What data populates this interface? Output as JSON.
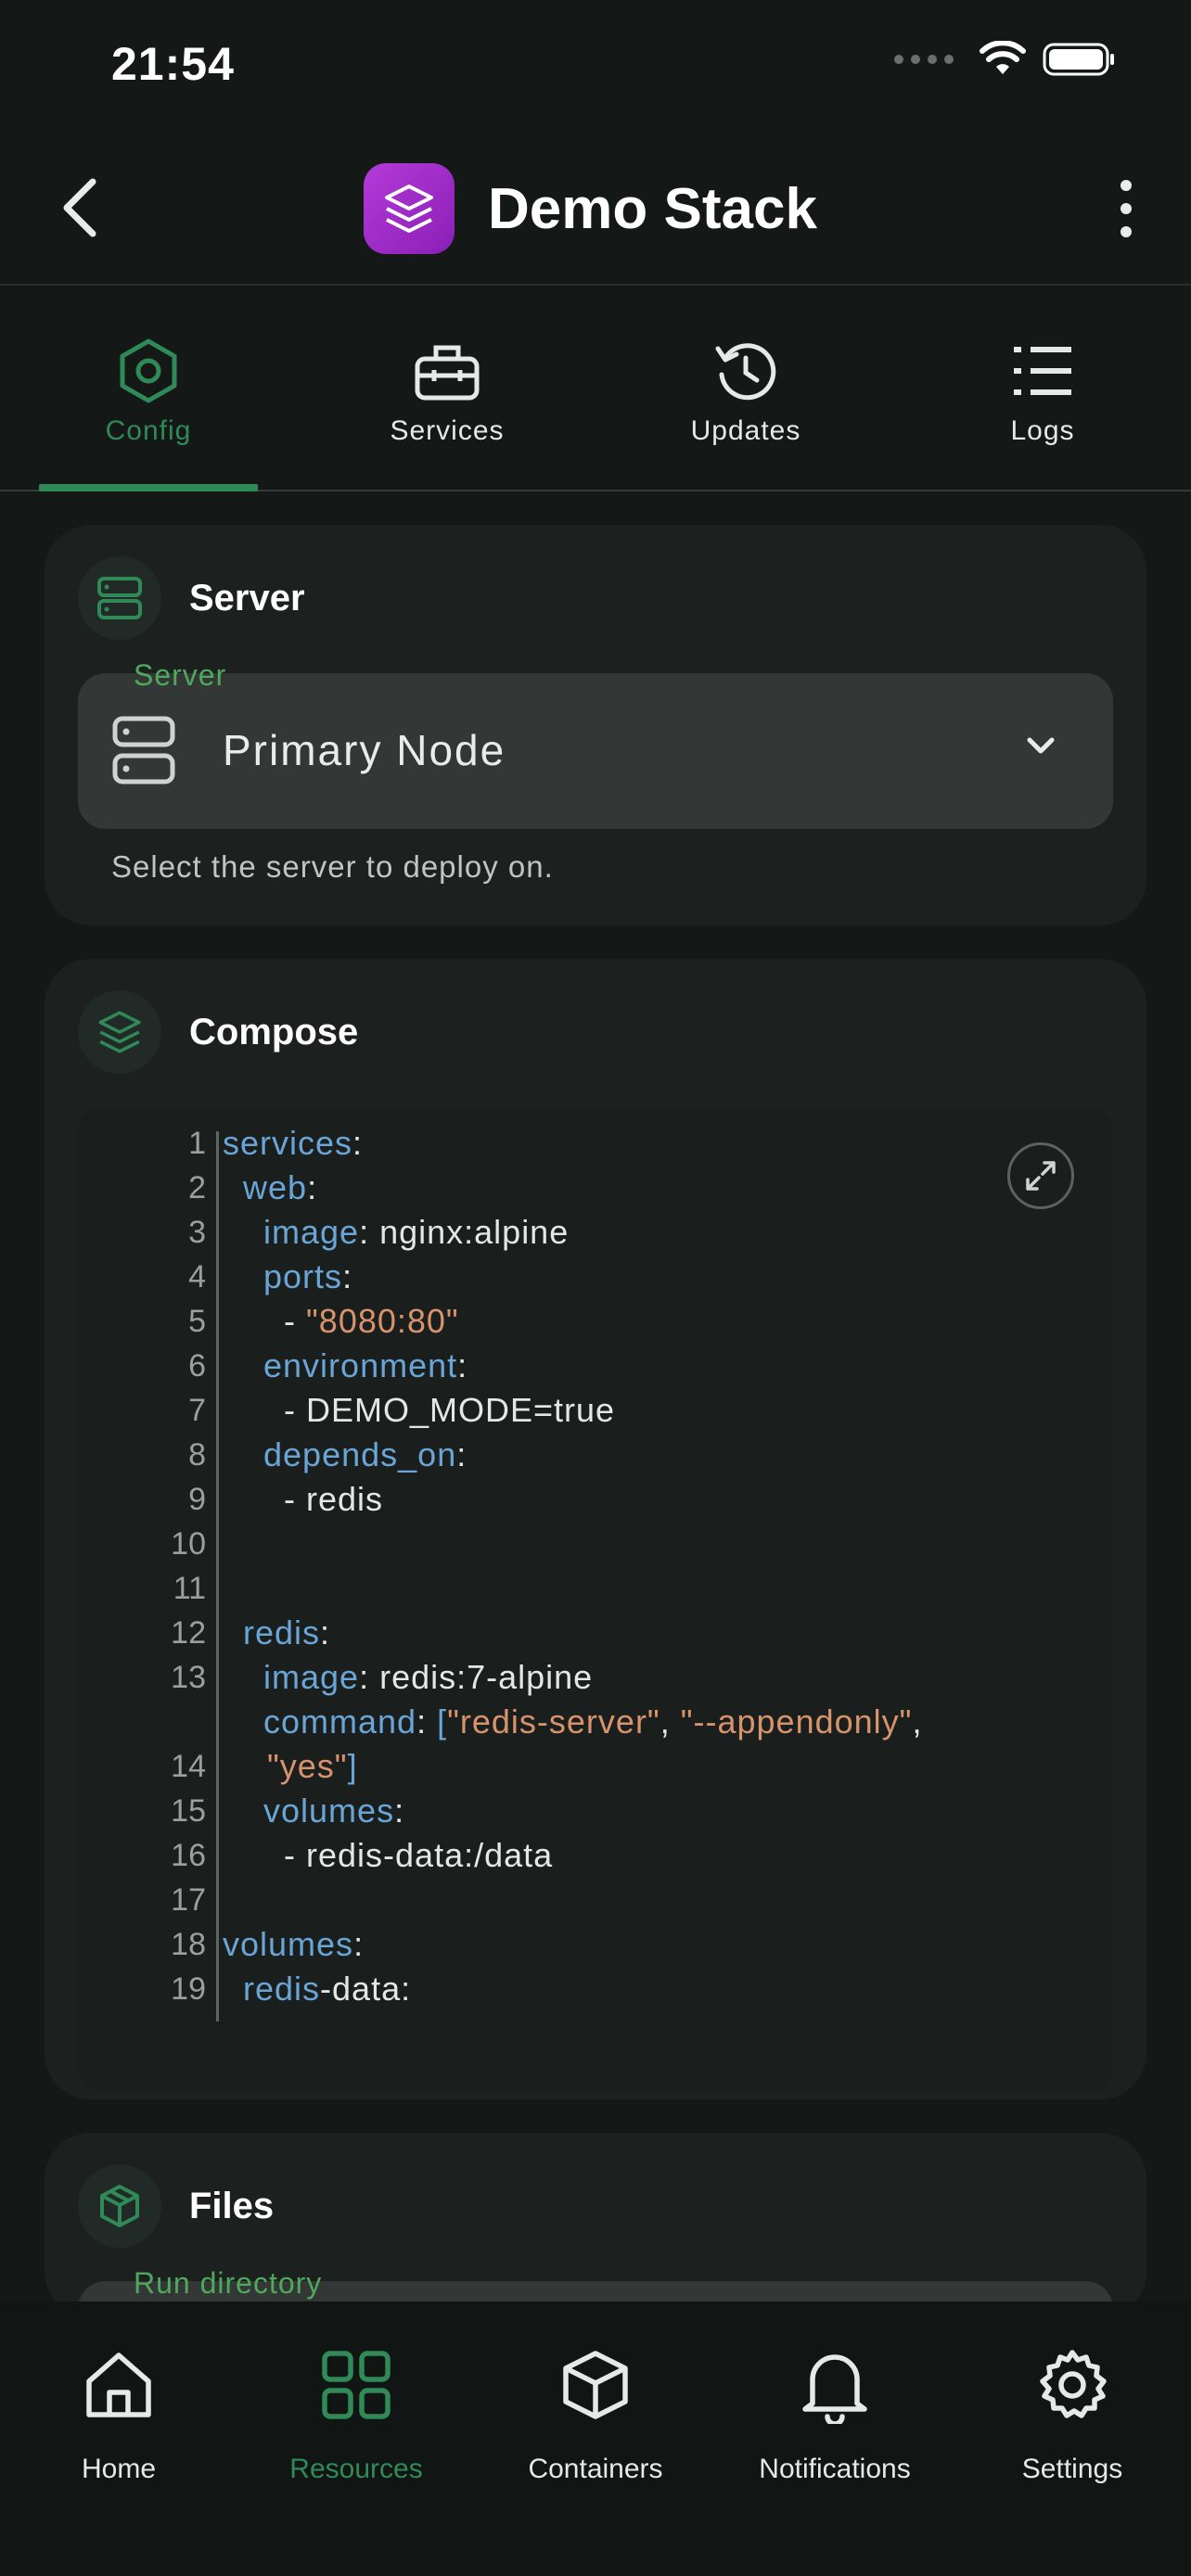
{
  "status_bar": {
    "time": "21:54"
  },
  "header": {
    "title": "Demo Stack"
  },
  "tabs": [
    {
      "label": "Config",
      "active": true
    },
    {
      "label": "Services",
      "active": false
    },
    {
      "label": "Updates",
      "active": false
    },
    {
      "label": "Logs",
      "active": false
    }
  ],
  "server_card": {
    "title": "Server",
    "field_label": "Server",
    "selected": "Primary Node",
    "helper": "Select the server to deploy on."
  },
  "compose_card": {
    "title": "Compose",
    "line_numbers": [
      "1",
      "2",
      "3",
      "4",
      "5",
      "6",
      "7",
      "8",
      "9",
      "10",
      "11",
      "12",
      "13",
      "14",
      "15",
      "16",
      "17",
      "18",
      "19"
    ]
  },
  "files_card": {
    "title": "Files",
    "field_label": "Run directory"
  },
  "bottom_nav": [
    {
      "label": "Home",
      "active": false
    },
    {
      "label": "Resources",
      "active": true
    },
    {
      "label": "Containers",
      "active": false
    },
    {
      "label": "Notifications",
      "active": false
    },
    {
      "label": "Settings",
      "active": false
    }
  ],
  "colors": {
    "accent": "#2f8a57",
    "field_label": "#4fa85c",
    "app_icon": "#b43ad8",
    "code_key": "#6aa5d6",
    "code_string": "#d7936b"
  },
  "code": {
    "l1k": "services",
    "l1p": ":",
    "l2i": "  ",
    "l2k": "web",
    "l2p": ":",
    "l3i": "    ",
    "l3k": "image",
    "l3v": ": nginx:alpine",
    "l4i": "    ",
    "l4k": "ports",
    "l4p": ":",
    "l5i": "      - ",
    "l5s": "\"8080:80\"",
    "l6i": "    ",
    "l6k": "environment",
    "l6p": ":",
    "l7v": "      - DEMO_MODE=true",
    "l8i": "    ",
    "l8k": "depends_on",
    "l8p": ":",
    "l9v": "      - redis",
    "l11i": "  ",
    "l11k": "redis",
    "l11p": ":",
    "l12i": "    ",
    "l12k": "image",
    "l12v": ": redis:7-alpine",
    "l13i": "    ",
    "l13k": "command",
    "l13p": ": ",
    "l13b1": "[",
    "l13s1": "\"redis-server\"",
    "l13c1": ", ",
    "l13s2": "\"--appendonly\"",
    "l13c2": ",",
    "l13bs": "\"yes\"",
    "l13b2": "]",
    "l14i": "    ",
    "l14k": "volumes",
    "l14p": ":",
    "l15v": "      - redis-data:/data",
    "l17k": "volumes",
    "l17p": ":",
    "l18i": "  ",
    "l18k": "redis",
    "l18v": "-data:"
  }
}
